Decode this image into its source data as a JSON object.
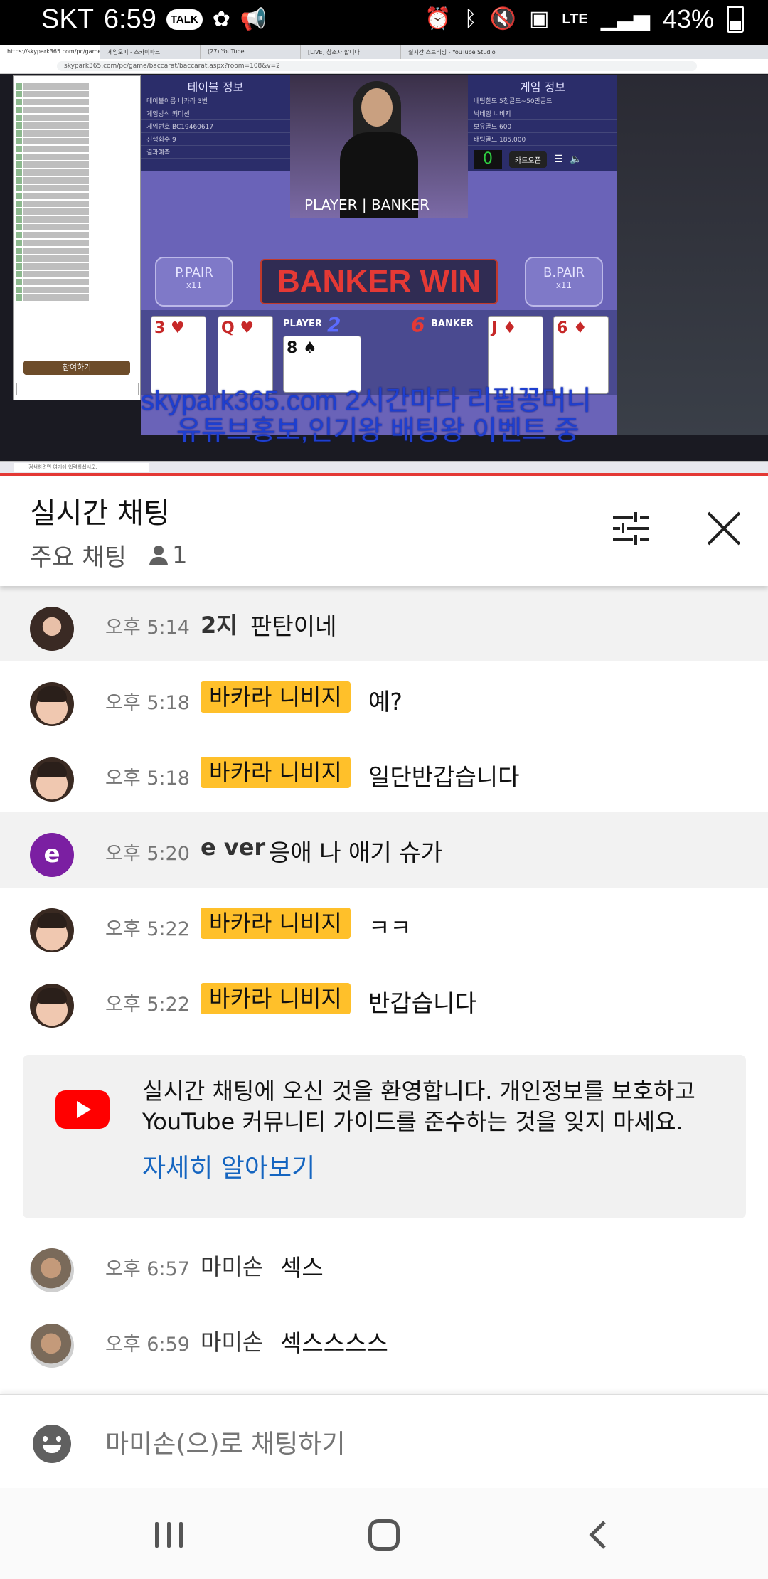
{
  "status_bar": {
    "carrier": "SKT",
    "time": "6:59",
    "talk_badge": "TALK",
    "network": "LTE",
    "battery": "43%"
  },
  "video": {
    "browser_tabs": [
      "https://skypark365.com/pc/game/",
      "게임오피 - 스카이파크",
      "(27) YouTube",
      "[LIVE] 창조자 합니다",
      "실시간 스트리밍 - YouTube Studio"
    ],
    "url": "skypark365.com/pc/game/baccarat/baccarat.aspx?room=108&v=2",
    "chat_join_button": "참여하기",
    "left_panel_title": "테이블 정보",
    "left_panel_rows": [
      "테이블이름  바카라 3번",
      "게임방식  커미션",
      "게임번호  BC19460617",
      "진행회수  9",
      "결과예측"
    ],
    "right_panel_title": "게임 정보",
    "right_panel_rows": [
      "배팅한도  5천골드~50만골드",
      "닉네임  니비지",
      "보유골드  600",
      "배팅골드  185,000"
    ],
    "card_open_button": "카드오픈",
    "bet_counter": "0",
    "table_label": "PLAYER | BANKER",
    "p_pair": "P.PAIR",
    "b_pair": "B.PAIR",
    "pair_odds": "x11",
    "result_banner": "BANKER WIN",
    "player_label": "PLAYER",
    "player_score": "2",
    "banker_label": "BANKER",
    "banker_score": "6",
    "player_cards": [
      "3 ♥",
      "Q ♥",
      "8 ♠"
    ],
    "banker_cards": [
      "J ♦",
      "6 ♦"
    ],
    "watermark_line1": "skypark365.com 2시간마다 리필꽁머니",
    "watermark_line2": "유튜브홍보,인기왕 배팅왕 이벤트 중",
    "taskbar_search": "검색하려면 여기에 입력하십시오."
  },
  "chat_header": {
    "title": "실시간 채팅",
    "subtitle": "주요 채팅",
    "viewer_count": "1"
  },
  "messages": [
    {
      "time": "오후 5:14",
      "author": "2지",
      "badge": false,
      "text": "판탄이네",
      "avatar": "woman"
    },
    {
      "time": "오후 5:18",
      "author": "바카라 니비지",
      "badge": true,
      "text": "예?",
      "avatar": "kid"
    },
    {
      "time": "오후 5:18",
      "author": "바카라 니비지",
      "badge": true,
      "text": "일단반갑습니다",
      "avatar": "kid"
    },
    {
      "time": "오후 5:20",
      "author": "e ver",
      "badge": false,
      "text": "응애 나 애기 슈가",
      "avatar": "e",
      "avatar_letter": "e"
    },
    {
      "time": "오후 5:22",
      "author": "바카라 니비지",
      "badge": true,
      "text": "ㅋㅋ",
      "avatar": "kid"
    },
    {
      "time": "오후 5:22",
      "author": "바카라 니비지",
      "badge": true,
      "text": "반갑습니다",
      "avatar": "kid"
    }
  ],
  "notice": {
    "text": "실시간 채팅에 오신 것을 환영합니다. 개인정보를 보호하고 YouTube 커뮤니티 가이드를 준수하는 것을 잊지 마세요.",
    "link": "자세히 알아보기"
  },
  "messages_after": [
    {
      "time": "오후 6:57",
      "author": "마미손",
      "text": "섹스",
      "avatar": "man"
    },
    {
      "time": "오후 6:59",
      "author": "마미손",
      "text": "섹스스스스",
      "avatar": "man"
    }
  ],
  "input": {
    "placeholder": "마미손(으)로 채팅하기"
  },
  "colors": {
    "badge": "#ffc02a",
    "link": "#1565c0",
    "youtube_red": "#ff0000",
    "avatar_e": "#7b1fa2"
  }
}
